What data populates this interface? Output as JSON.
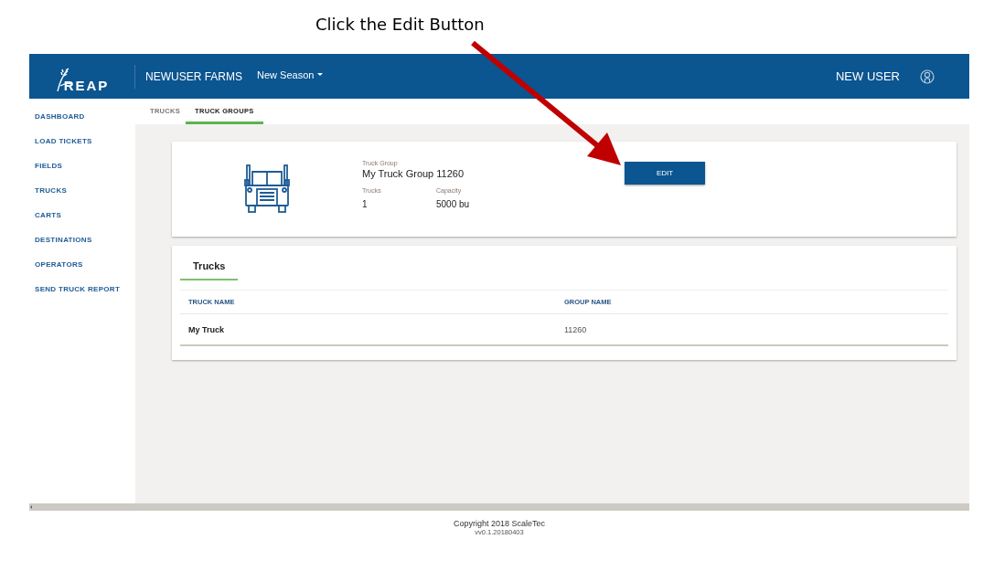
{
  "caption": "Click the Edit Button",
  "header": {
    "logo_text": "REAP",
    "farm": "NEWUSER FARMS",
    "season": "New Season",
    "user": "NEW USER"
  },
  "sidebar": {
    "items": [
      {
        "label": "DASHBOARD"
      },
      {
        "label": "LOAD TICKETS"
      },
      {
        "label": "FIELDS"
      },
      {
        "label": "TRUCKS"
      },
      {
        "label": "CARTS"
      },
      {
        "label": "DESTINATIONS"
      },
      {
        "label": "OPERATORS"
      },
      {
        "label": "SEND TRUCK REPORT"
      }
    ]
  },
  "tabs": [
    {
      "label": "TRUCKS",
      "selected": false
    },
    {
      "label": "TRUCK GROUPS",
      "selected": true
    }
  ],
  "group_card": {
    "label": "Truck Group",
    "name": "My Truck Group 11260",
    "stats": [
      {
        "label": "Trucks",
        "value": "1"
      },
      {
        "label": "Capacity",
        "value": "5000 bu"
      }
    ],
    "button": "EDIT"
  },
  "trucks_card": {
    "tabs": [
      {
        "label": "Trucks",
        "selected": true
      }
    ],
    "columns": [
      "TRUCK NAME",
      "GROUP NAME"
    ],
    "rows": [
      [
        "My Truck",
        "11260"
      ]
    ]
  },
  "footer": {
    "copyright": "Copyright 2018 ScaleTec",
    "version": "vv0.1.20180403"
  }
}
